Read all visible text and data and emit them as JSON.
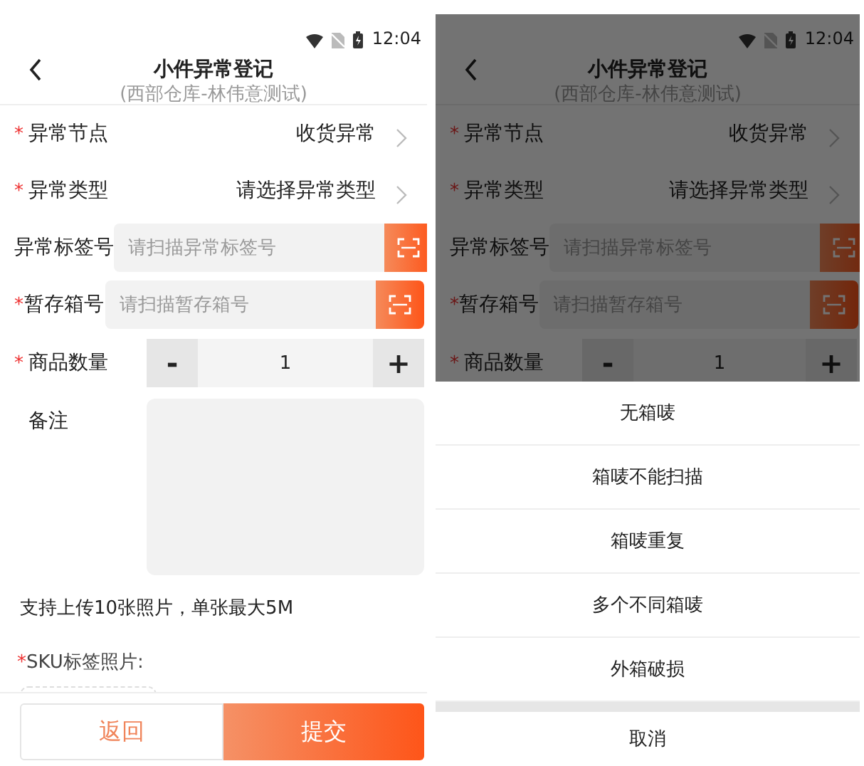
{
  "screens": [
    {
      "status_bar": {
        "time": "12:04"
      },
      "header": {
        "title": "小件异常登记",
        "subtitle": "(西部仓库-林伟意测试)"
      },
      "fields": [
        {
          "kind": "select",
          "label": "异常节点",
          "required_mark": "*",
          "value": "收货异常"
        },
        {
          "kind": "select",
          "label": "异常类型",
          "required_mark": "*",
          "value": "请选择异常类型"
        },
        {
          "kind": "scan",
          "label": "异常标签号",
          "placeholder": "请扫描异常标签号"
        },
        {
          "kind": "scan",
          "label": "暂存箱号",
          "required_mark": "*",
          "placeholder": "请扫描暂存箱号"
        },
        {
          "kind": "stepper",
          "label": "商品数量",
          "required_mark": "*",
          "minus": "-",
          "value": "1",
          "plus": "+"
        },
        {
          "kind": "textarea",
          "label": "备注"
        }
      ],
      "upload_hint": "支持上传10张照片，单张最大5M",
      "photo_label": {
        "label": "SKU标签照片:",
        "required_mark": "*"
      },
      "footer": {
        "back": "返回",
        "submit": "提交"
      }
    },
    {
      "status_bar": {
        "time": "12:04"
      },
      "header": {
        "title": "小件异常登记",
        "subtitle": "(西部仓库-林伟意测试)"
      },
      "fields": [
        {
          "kind": "select",
          "label": "异常节点",
          "required_mark": "*",
          "value": "收货异常"
        },
        {
          "kind": "select",
          "label": "异常类型",
          "required_mark": "*",
          "value": "请选择异常类型"
        },
        {
          "kind": "scan",
          "label": "异常标签号",
          "placeholder": "请扫描异常标签号"
        },
        {
          "kind": "scan",
          "label": "暂存箱号",
          "required_mark": "*",
          "placeholder": "请扫描暂存箱号"
        },
        {
          "kind": "stepper",
          "label": "商品数量",
          "required_mark": "*",
          "minus": "-",
          "value": "1",
          "plus": "+"
        }
      ],
      "action_sheet": {
        "options": [
          "无箱唛",
          "箱唛不能扫描",
          "箱唛重复",
          "多个不同箱唛",
          "外箱破损"
        ],
        "cancel": "取消"
      }
    }
  ]
}
